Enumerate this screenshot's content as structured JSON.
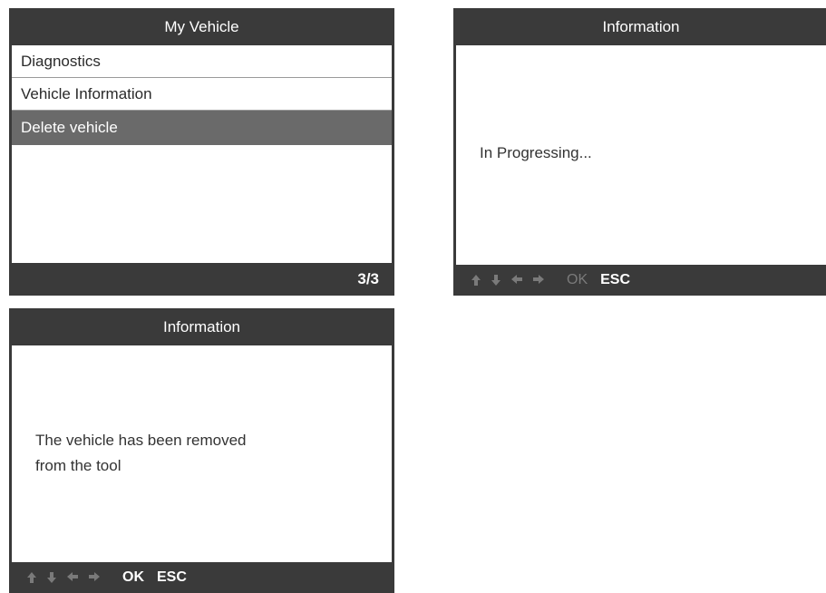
{
  "screens": {
    "my_vehicle": {
      "title": "My Vehicle",
      "menu_items": [
        "Diagnostics",
        "Vehicle Information",
        "Delete vehicle"
      ],
      "selected_index": 2,
      "page_indicator": "3/3"
    },
    "info_progress": {
      "title": "Information",
      "message": "In Progressing...",
      "keys": {
        "ok": "OK",
        "esc": "ESC"
      }
    },
    "info_removed": {
      "title": "Information",
      "message": "The vehicle has been removed\nfrom the tool",
      "keys": {
        "ok": "OK",
        "esc": "ESC"
      }
    }
  },
  "icons": [
    "arrow-up-icon",
    "arrow-down-icon",
    "arrow-left-icon",
    "arrow-right-icon"
  ],
  "colors": {
    "bar_background": "#3a3a3a",
    "selected_item": "#6a6a6a",
    "disabled_key": "#7a7a7a"
  }
}
